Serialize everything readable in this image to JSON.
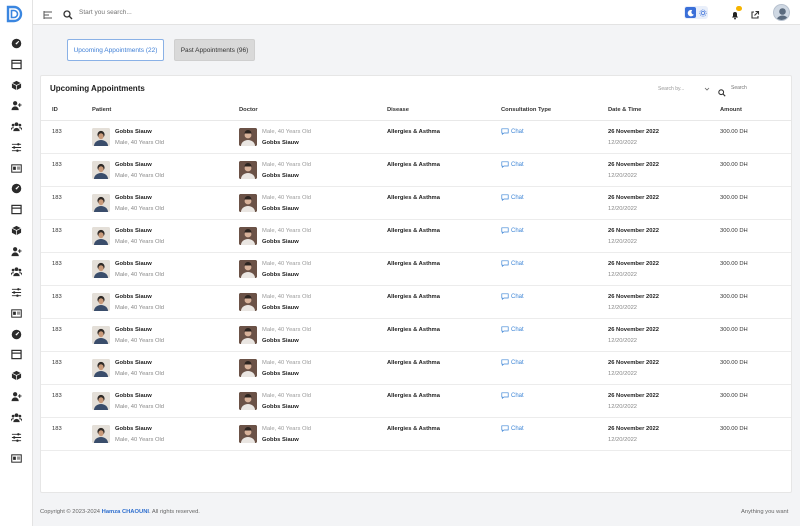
{
  "topbar": {
    "search_placeholder": "Start you search..."
  },
  "tabs": {
    "upcoming_label": "Upcoming Appointments (22)",
    "past_label": "Past Appointments (96)"
  },
  "card": {
    "title": "Upcoming Appointments",
    "search_by_placeholder": "Search by...",
    "search_placeholder": "Search"
  },
  "table": {
    "columns": [
      "ID",
      "Patient",
      "Doctor",
      "Disease",
      "Consultation Type",
      "Date & Time",
      "Amount"
    ],
    "rows": [
      {
        "id": "183",
        "patient_name": "Gobbs Siauw",
        "patient_info": "Male, 40 Years Old",
        "doctor_info": "Male, 40 Years Old",
        "doctor_name": "Gobbs Siauw",
        "disease": "Allergies & Asthma",
        "consultation": "Chat",
        "date": "26 November 2022",
        "date_short": "12/20/2022",
        "amount": "300.00 DH"
      },
      {
        "id": "183",
        "patient_name": "Gobbs Siauw",
        "patient_info": "Male, 40 Years Old",
        "doctor_info": "Male, 40 Years Old",
        "doctor_name": "Gobbs Siauw",
        "disease": "Allergies & Asthma",
        "consultation": "Chat",
        "date": "26 November 2022",
        "date_short": "12/20/2022",
        "amount": "300.00 DH"
      },
      {
        "id": "183",
        "patient_name": "Gobbs Siauw",
        "patient_info": "Male, 40 Years Old",
        "doctor_info": "Male, 40 Years Old",
        "doctor_name": "Gobbs Siauw",
        "disease": "Allergies & Asthma",
        "consultation": "Chat",
        "date": "26 November 2022",
        "date_short": "12/20/2022",
        "amount": "300.00 DH"
      },
      {
        "id": "183",
        "patient_name": "Gobbs Siauw",
        "patient_info": "Male, 40 Years Old",
        "doctor_info": "Male, 40 Years Old",
        "doctor_name": "Gobbs Siauw",
        "disease": "Allergies & Asthma",
        "consultation": "Chat",
        "date": "26 November 2022",
        "date_short": "12/20/2022",
        "amount": "300.00 DH"
      },
      {
        "id": "183",
        "patient_name": "Gobbs Siauw",
        "patient_info": "Male, 40 Years Old",
        "doctor_info": "Male, 40 Years Old",
        "doctor_name": "Gobbs Siauw",
        "disease": "Allergies & Asthma",
        "consultation": "Chat",
        "date": "26 November 2022",
        "date_short": "12/20/2022",
        "amount": "300.00 DH"
      },
      {
        "id": "183",
        "patient_name": "Gobbs Siauw",
        "patient_info": "Male, 40 Years Old",
        "doctor_info": "Male, 40 Years Old",
        "doctor_name": "Gobbs Siauw",
        "disease": "Allergies & Asthma",
        "consultation": "Chat",
        "date": "26 November 2022",
        "date_short": "12/20/2022",
        "amount": "300.00 DH"
      },
      {
        "id": "183",
        "patient_name": "Gobbs Siauw",
        "patient_info": "Male, 40 Years Old",
        "doctor_info": "Male, 40 Years Old",
        "doctor_name": "Gobbs Siauw",
        "disease": "Allergies & Asthma",
        "consultation": "Chat",
        "date": "26 November 2022",
        "date_short": "12/20/2022",
        "amount": "300.00 DH"
      },
      {
        "id": "183",
        "patient_name": "Gobbs Siauw",
        "patient_info": "Male, 40 Years Old",
        "doctor_info": "Male, 40 Years Old",
        "doctor_name": "Gobbs Siauw",
        "disease": "Allergies & Asthma",
        "consultation": "Chat",
        "date": "26 November 2022",
        "date_short": "12/20/2022",
        "amount": "300.00 DH"
      },
      {
        "id": "183",
        "patient_name": "Gobbs Siauw",
        "patient_info": "Male, 40 Years Old",
        "doctor_info": "Male, 40 Years Old",
        "doctor_name": "Gobbs Siauw",
        "disease": "Allergies & Asthma",
        "consultation": "Chat",
        "date": "26 November 2022",
        "date_short": "12/20/2022",
        "amount": "300.00 DH"
      },
      {
        "id": "183",
        "patient_name": "Gobbs Siauw",
        "patient_info": "Male, 40 Years Old",
        "doctor_info": "Male, 40 Years Old",
        "doctor_name": "Gobbs Siauw",
        "disease": "Allergies & Asthma",
        "consultation": "Chat",
        "date": "26 November 2022",
        "date_short": "12/20/2022",
        "amount": "300.00 DH"
      }
    ]
  },
  "footer": {
    "prefix": "Copyright © 2023-2024 ",
    "author": "Hamza CHAOUNI",
    "suffix": ". All rights reserved.",
    "right": "Anything you want"
  },
  "sidebar": {
    "icons": [
      "gauge-icon",
      "calendar-icon",
      "box-icon",
      "add-user-icon",
      "users-icon",
      "sliders-icon",
      "id-card-icon",
      "gauge-icon",
      "calendar-icon",
      "box-icon",
      "add-user-icon",
      "users-icon",
      "sliders-icon",
      "id-card-icon",
      "gauge-icon",
      "calendar-icon",
      "box-icon",
      "add-user-icon",
      "users-icon",
      "sliders-icon",
      "id-card-icon"
    ]
  },
  "colors": {
    "accent": "#3f7fd6",
    "badge": "#f6b400"
  }
}
